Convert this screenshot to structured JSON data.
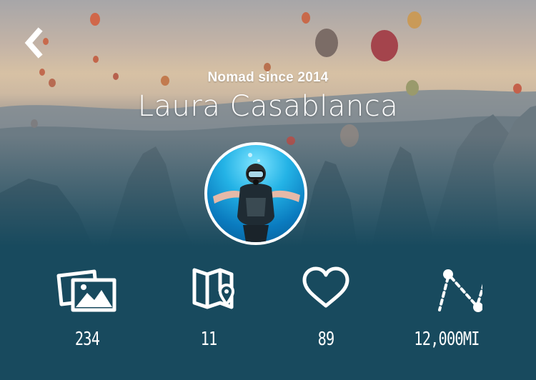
{
  "profile": {
    "subtitle": "Nomad since 2014",
    "name": "Laura Casablanca"
  },
  "stats": [
    {
      "icon": "photos-icon",
      "value": "234"
    },
    {
      "icon": "map-icon",
      "value": "11"
    },
    {
      "icon": "heart-icon",
      "value": "89"
    },
    {
      "icon": "route-icon",
      "value": "12,000MI"
    }
  ],
  "colors": {
    "panel": "#184a5e",
    "text": "#ffffff"
  }
}
